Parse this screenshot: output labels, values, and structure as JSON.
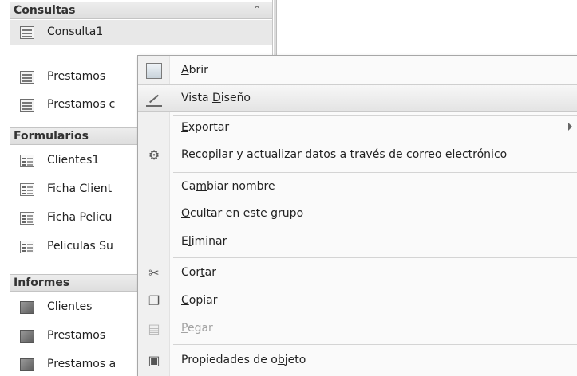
{
  "nav": {
    "groups": [
      {
        "title": "Consultas",
        "items": [
          "Consulta1",
          "Prestamos",
          "Prestamos c"
        ]
      },
      {
        "title": "Formularios",
        "items": [
          "Clientes1",
          "Ficha Client",
          "Ficha Pelicu",
          "Peliculas Su"
        ]
      },
      {
        "title": "Informes",
        "items": [
          "Clientes",
          "Prestamos",
          "Prestamos a"
        ]
      }
    ],
    "collapse_glyph": "⌃"
  },
  "menu": {
    "open": {
      "pre": "",
      "key": "A",
      "post": "brir"
    },
    "design_view": {
      "pre": "Vista ",
      "key": "D",
      "post": "iseño"
    },
    "export": {
      "pre": "",
      "key": "E",
      "post": "xportar"
    },
    "collect": {
      "pre": "",
      "key": "R",
      "post": "ecopilar y actualizar datos a través de correo electrónico"
    },
    "rename": {
      "pre": "Ca",
      "key": "m",
      "post": "biar nombre"
    },
    "hide": {
      "pre": "",
      "key": "O",
      "post": "cultar en este grupo"
    },
    "delete": {
      "pre": "E",
      "key": "l",
      "post": "iminar"
    },
    "cut": {
      "pre": "Cor",
      "key": "t",
      "post": "ar"
    },
    "copy": {
      "pre": "",
      "key": "C",
      "post": "opiar"
    },
    "paste": {
      "pre": "",
      "key": "P",
      "post": "egar"
    },
    "properties": {
      "pre": "Propiedades de o",
      "key": "b",
      "post": "jeto"
    }
  }
}
